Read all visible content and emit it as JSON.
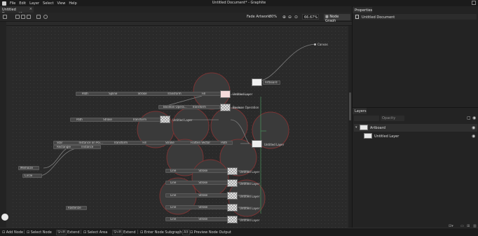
{
  "window": {
    "title": "Untitled Document* - Graphite"
  },
  "menu": {
    "items": [
      "File",
      "Edit",
      "Layer",
      "Select",
      "View",
      "Help"
    ]
  },
  "tab": {
    "label": "Untitled Document*",
    "close": "×"
  },
  "controlbar": {
    "fade_label": "Fade Artwork",
    "fade_value": "80%",
    "zoom_value": "66.67%",
    "node_graph_label": "Node Graph"
  },
  "graph": {
    "output_label": "Canvas",
    "nodes": {
      "artboard": "Artboard",
      "layer_main": "Untitled Layer",
      "boolean": "Boolean Operation",
      "row1": [
        "Path",
        "Spline",
        "Stroke",
        "Transform",
        "Fill"
      ],
      "row2": [
        "Boolean Opera…",
        "Transform"
      ],
      "row3": [
        "Path",
        "Stroke",
        "Transform"
      ],
      "row4a": [
        "Star",
        "Instance on Poi…",
        "Transform",
        "Fill",
        "Stroke",
        "Flatten Vector",
        "Path"
      ],
      "row4b": [
        "Rectangle",
        "Instance"
      ],
      "memoize": "Memoize",
      "circle": "Circle",
      "rasterize": "Rasterize",
      "lines": [
        "Line",
        "Stroke",
        "Untitled Layer"
      ]
    }
  },
  "properties": {
    "header": "Properties",
    "doc_label": "Untitled Document"
  },
  "layers": {
    "header": "Layers",
    "opacity_placeholder": "Opacity",
    "rows": [
      {
        "label": "Artboard"
      },
      {
        "label": "Untitled Layer"
      }
    ]
  },
  "status": {
    "items": [
      {
        "label": "Add Node"
      },
      {
        "label": "Select Node"
      },
      {
        "key": "Shift",
        "label": "Extend"
      },
      {
        "label": "Select Area"
      },
      {
        "key": "Shift",
        "label": "Extend"
      },
      {
        "label": "Enter Node Subgraph"
      },
      {
        "key": "Alt",
        "label": "Preview Node Output"
      }
    ]
  }
}
